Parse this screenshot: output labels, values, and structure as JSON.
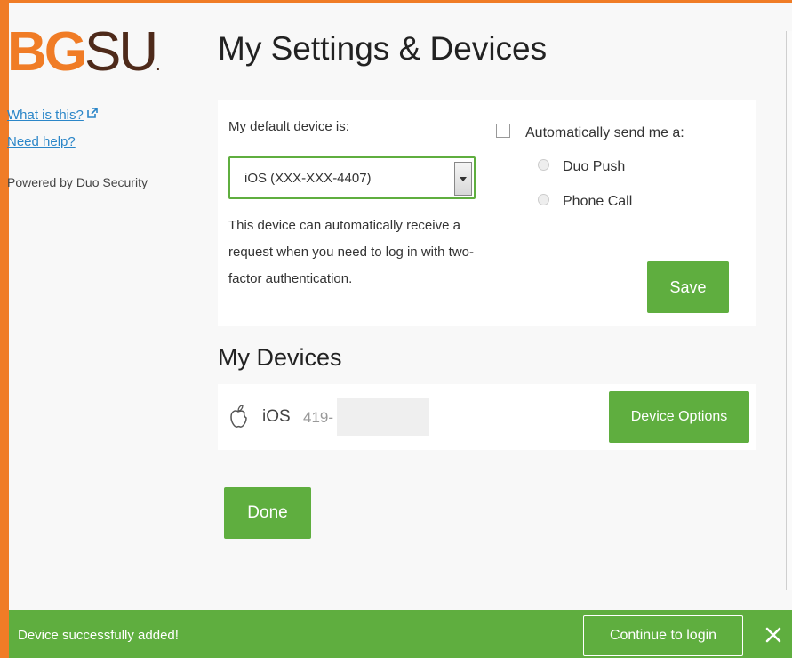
{
  "sidebar": {
    "logo_bold": "BG",
    "logo_rest": "SU",
    "logo_dot": ".",
    "what_is_this": "What is this?",
    "need_help": "Need help?",
    "powered_by": "Powered by Duo Security"
  },
  "header": {
    "title": "My Settings & Devices"
  },
  "settings": {
    "default_label": "My default device is:",
    "selected_device": "iOS (XXX-XXX-4407)",
    "device_description": "This device can automatically receive a request when you need to log in with two-factor authentication.",
    "auto_send_label": "Automatically send me a:",
    "auto_send_checked": false,
    "options": [
      "Duo Push",
      "Phone Call"
    ],
    "save_label": "Save"
  },
  "devices": {
    "title": "My Devices",
    "items": [
      {
        "os": "iOS",
        "number_partial": "419-",
        "options_label": "Device Options",
        "icon": "apple-icon"
      }
    ]
  },
  "done_label": "Done",
  "notification": {
    "message": "Device successfully added!",
    "continue_label": "Continue to login",
    "close_symbol": "✕"
  },
  "colors": {
    "accent": "#f07c26",
    "brand_brown": "#4e2a1a",
    "success": "#5fae3f",
    "link": "#2b86c8"
  }
}
